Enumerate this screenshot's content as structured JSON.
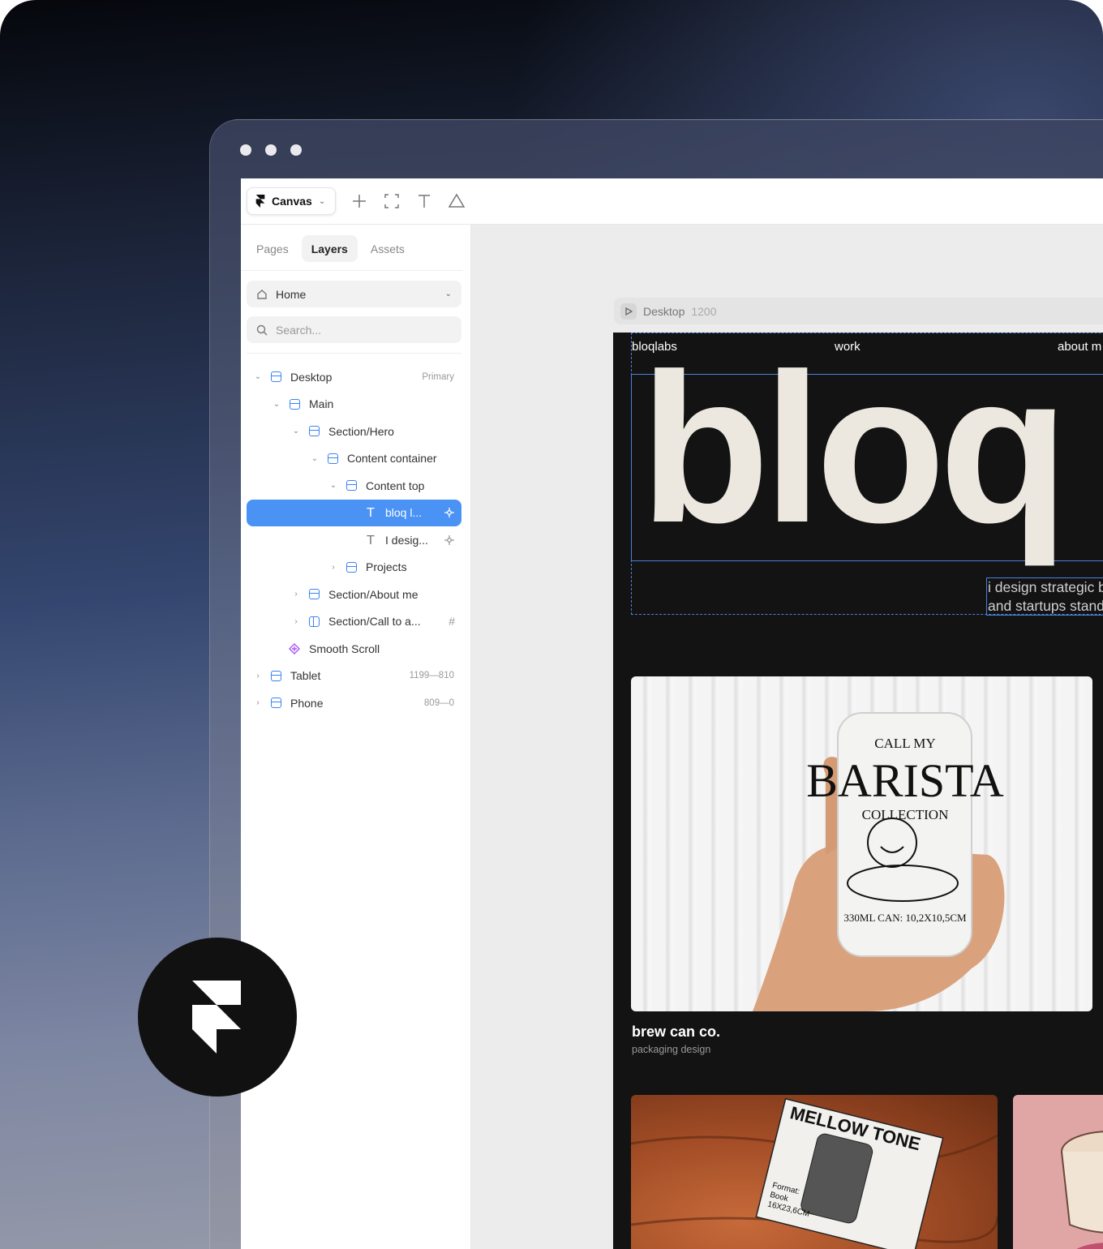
{
  "toolbar": {
    "canvas_label": "Canvas"
  },
  "sidebar": {
    "tabs": [
      "Pages",
      "Layers",
      "Assets"
    ],
    "page_select": "Home",
    "search_placeholder": "Search...",
    "layers": [
      {
        "label": "Desktop",
        "meta": "Primary"
      },
      {
        "label": "Main"
      },
      {
        "label": "Section/Hero"
      },
      {
        "label": "Content container"
      },
      {
        "label": "Content top"
      },
      {
        "label": "bloq l..."
      },
      {
        "label": "I desig..."
      },
      {
        "label": "Projects"
      },
      {
        "label": "Section/About me"
      },
      {
        "label": "Section/Call to a..."
      },
      {
        "label": "Smooth Scroll"
      },
      {
        "label": "Tablet",
        "meta": "1199—810"
      },
      {
        "label": "Phone",
        "meta": "809—0"
      }
    ]
  },
  "canvas": {
    "frame_name": "Desktop",
    "frame_width": "1200",
    "site": {
      "nav": [
        "bloqlabs",
        "work",
        "about m"
      ],
      "hero": "bloq la",
      "tagline_1": "i design strategic b",
      "tagline_2": "and startups stand",
      "project_1": {
        "title": "brew can co.",
        "subtitle": "packaging design",
        "can_text": [
          "CALL MY",
          "BARISTA",
          "COLLECTION",
          "330ML CAN: 10,2X10,5CM"
        ]
      },
      "project_2": {
        "book_text": [
          "MELLOW TONE",
          "Format:",
          "Book",
          "16X23,6CM"
        ]
      }
    }
  },
  "colors": {
    "selection": "#4b92f5",
    "frame_icon": "#3b82f6",
    "component": "#a855f7"
  }
}
